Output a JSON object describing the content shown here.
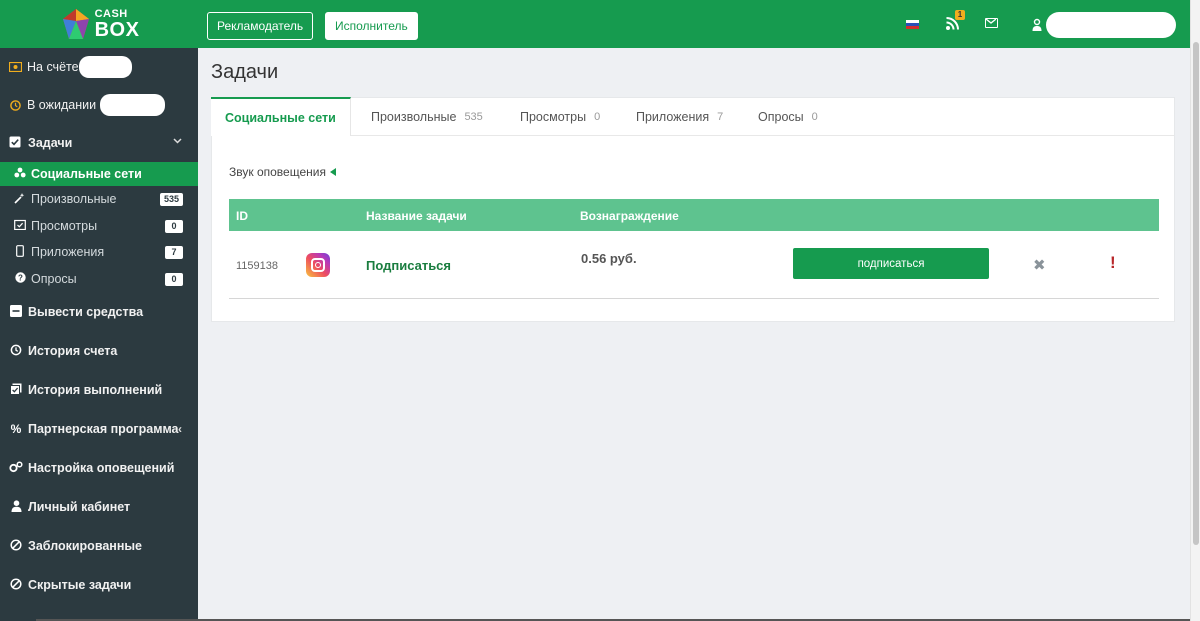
{
  "brand": {
    "line1": "CASH",
    "line2": "BOX"
  },
  "sidebar": {
    "balance": {
      "on_account": "На счёте",
      "pending": "В ожидании"
    },
    "tasks_group": {
      "label": "Задачи",
      "items": [
        {
          "label": "Социальные сети",
          "badge": ""
        },
        {
          "label": "Произвольные",
          "badge": "535"
        },
        {
          "label": "Просмотры",
          "badge": "0"
        },
        {
          "label": "Приложения",
          "badge": "7"
        },
        {
          "label": "Опросы",
          "badge": "0"
        }
      ]
    },
    "menu": [
      {
        "label": "Вывести средства"
      },
      {
        "label": "История счета"
      },
      {
        "label": "История выполнений"
      },
      {
        "label": "Партнерская программа"
      },
      {
        "label": "Настройка оповещений"
      },
      {
        "label": "Личный кабинет"
      },
      {
        "label": "Заблокированные"
      },
      {
        "label": "Скрытые задачи"
      }
    ]
  },
  "topbar": {
    "advertiser_label": "Рекламодатель",
    "executor_label": "Исполнитель",
    "notification_count": "1"
  },
  "main": {
    "title": "Задачи",
    "tabs": [
      {
        "label": "Социальные сети",
        "count": ""
      },
      {
        "label": "Произвольные",
        "count": "535"
      },
      {
        "label": "Просмотры",
        "count": "0"
      },
      {
        "label": "Приложения",
        "count": "7"
      },
      {
        "label": "Опросы",
        "count": "0"
      }
    ],
    "sound_label": "Звук оповещения",
    "table": {
      "headers": {
        "id": "ID",
        "name": "Название задачи",
        "reward": "Вознаграждение"
      },
      "rows": [
        {
          "id": "1159138",
          "name": "Подписаться",
          "reward": "0.56 руб.",
          "action": "подписаться",
          "platform_icon": "instagram-icon"
        }
      ]
    }
  },
  "colors": {
    "primary": "#169b4f",
    "sidebar_bg": "#2c3a40",
    "table_header": "#5ec38f",
    "alert": "#b8272a"
  }
}
